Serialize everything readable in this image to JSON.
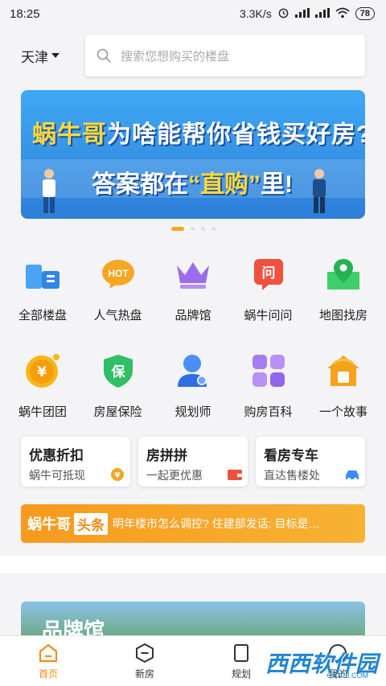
{
  "status_bar": {
    "time": "18:25",
    "speed": "3.3K/s",
    "battery": "78"
  },
  "header": {
    "city": "天津",
    "search_placeholder": "搜索您想购买的楼盘"
  },
  "banner": {
    "brand": "蜗牛哥",
    "line1_rest": "为啥能帮你省钱买好房?",
    "line2_prefix": "答案都在",
    "line2_highlight": "“直购”",
    "line2_suffix": "里!"
  },
  "grid": {
    "row1": [
      {
        "label": "全部楼盘",
        "icon": "buildings-icon"
      },
      {
        "label": "人气热盘",
        "icon": "hot-bubble-icon"
      },
      {
        "label": "品牌馆",
        "icon": "crown-icon"
      },
      {
        "label": "蜗牛问问",
        "icon": "question-bubble-icon"
      },
      {
        "label": "地图找房",
        "icon": "map-pin-icon"
      }
    ],
    "row2": [
      {
        "label": "蜗牛团团",
        "icon": "yuan-coin-icon"
      },
      {
        "label": "房屋保险",
        "icon": "shield-icon"
      },
      {
        "label": "规划师",
        "icon": "user-star-icon"
      },
      {
        "label": "购房百科",
        "icon": "grid-squares-icon"
      },
      {
        "label": "一个故事",
        "icon": "house-story-icon"
      }
    ]
  },
  "cards": [
    {
      "title": "优惠折扣",
      "sub": "蜗牛可抵现"
    },
    {
      "title": "房拼拼",
      "sub": "一起更优惠"
    },
    {
      "title": "看房专车",
      "sub": "直达售楼处"
    }
  ],
  "news": {
    "brand": "蜗牛哥",
    "tag": "头条",
    "text": "明年楼市怎么调控? 住建部发话: 目标是…"
  },
  "brand_banner": {
    "title": "品牌馆"
  },
  "tabs": [
    {
      "label": "首页"
    },
    {
      "label": "新房"
    },
    {
      "label": "规划"
    },
    {
      "label": "我的"
    }
  ],
  "watermark": {
    "text": "西西软件园",
    "sub": "CR173.COM"
  },
  "colors": {
    "accent": "#f08c13",
    "banner_blue": "#3fa9f5",
    "tab_active": "#f08c13"
  }
}
